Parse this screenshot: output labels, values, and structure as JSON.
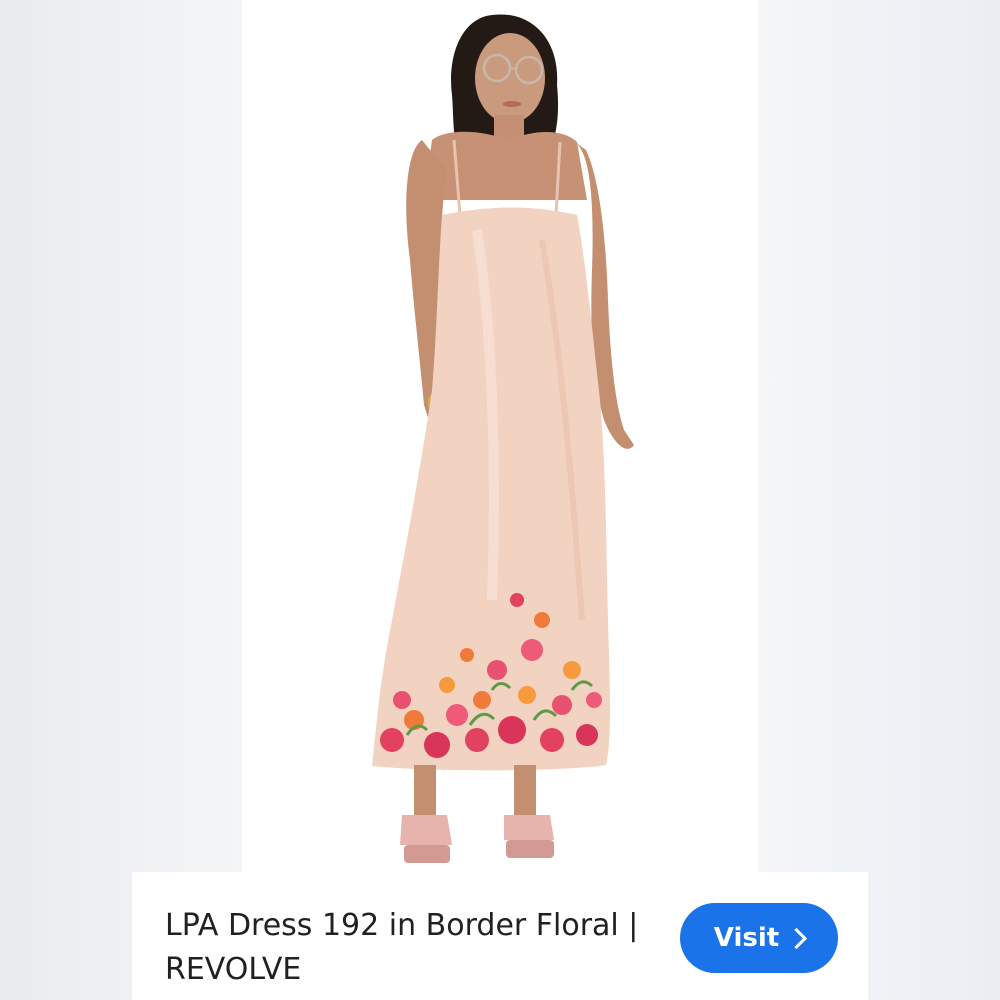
{
  "product": {
    "image_alt": "Model wearing a blush pink satin slip maxi dress with a floral border hem",
    "image_description_icon": "product-photo"
  },
  "caption": {
    "title": "LPA Dress 192 in Border Floral | REVOLVE"
  },
  "actions": {
    "visit_label": "Visit",
    "visit_icon": "chevron-right-icon",
    "visit_color": "#1a73e8"
  },
  "colors": {
    "dress": "#f2d3c2",
    "floral_primary": "#e2425f",
    "floral_secondary": "#f07a3a",
    "shoes": "#e7b3ad"
  }
}
